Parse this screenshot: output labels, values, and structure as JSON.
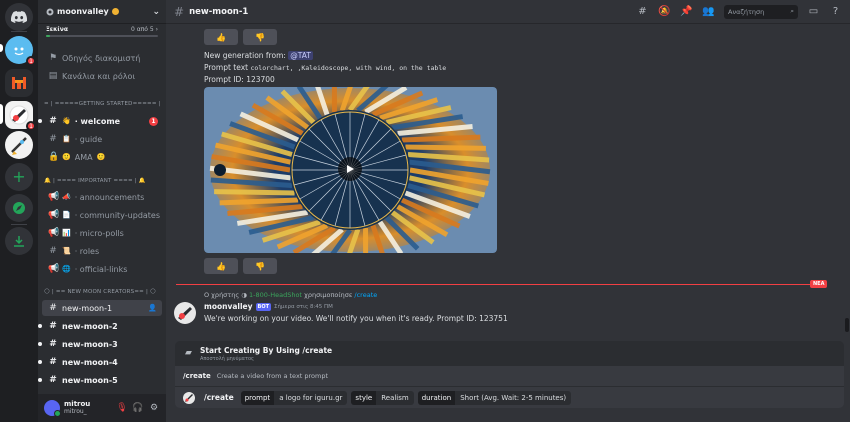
{
  "server": {
    "name": "moonvalley",
    "boost_label": "Ξεκίνα",
    "boost_count": "0 από 5",
    "boost_progress": 0.04
  },
  "sidebar": {
    "guide_item": "Οδηγός διακομιστή",
    "roles_item": "Κανάλια και ρόλοι",
    "categories": {
      "getting_started": "= | =====GETTING STARTED===== |",
      "important": "| ==== IMPORTANT ==== |",
      "new_moon": "| == NEW MOON CREATORS== |"
    },
    "channels": [
      {
        "name": "· welcome",
        "badge": "1"
      },
      {
        "name": "· guide"
      },
      {
        "name": "AMA"
      },
      {
        "name": "· announcements"
      },
      {
        "name": "· community-updates"
      },
      {
        "name": "· micro-polls"
      },
      {
        "name": "· roles"
      },
      {
        "name": "· official-links"
      },
      {
        "name": "new-moon-1"
      },
      {
        "name": "new-moon-2"
      },
      {
        "name": "new-moon-3"
      },
      {
        "name": "new-moon-4"
      },
      {
        "name": "new-moon-5"
      }
    ]
  },
  "rail_badges": {
    "server_a": "1",
    "server_b": "1"
  },
  "user": {
    "name": "mitrou",
    "tag": "mitrou_"
  },
  "header": {
    "channel": "new-moon-1",
    "search_placeholder": "Αναζήτηση"
  },
  "message1": {
    "line1_prefix": "New generation from:",
    "mention": "@TAT",
    "line2_prefix": "Prompt text",
    "prompt_text": "colorchart, ,Kaleidoscope, with wind, on the table",
    "line3": "Prompt ID: 123700"
  },
  "reply": {
    "prefix": "Ο χρήστης",
    "user": "1-800-HeadShot",
    "used": "χρησιμοποίησε",
    "command": "/create"
  },
  "new_tag": "ΝΕΑ",
  "message2": {
    "author": "moonvalley",
    "bot_tag": "BOT",
    "time": "Σήμερα στις 8:45 ΠΜ",
    "text": "We're working on your video. We'll notify you when it's ready. Prompt ID: 123751"
  },
  "command_panel": {
    "title": "Start Creating By Using /create",
    "subtitle": "Αποστολή μηνύματος",
    "suggestion_name": "/create",
    "suggestion_desc": "Create a video from a text prompt"
  },
  "input": {
    "command": "/create",
    "options": [
      {
        "key": "prompt",
        "value": "a logo for iguru.gr"
      },
      {
        "key": "style",
        "value": "Realism"
      },
      {
        "key": "duration",
        "value": "Short (Avg. Wait: 2-5 minutes)"
      }
    ]
  },
  "colors": {
    "accent": "#5865f2",
    "danger": "#f23f43",
    "online": "#23a55a"
  }
}
